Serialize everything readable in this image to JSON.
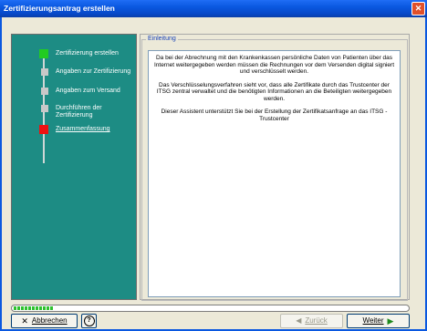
{
  "window": {
    "title": "Zertifizierungsantrag erstellen"
  },
  "steps": [
    {
      "label": "Zertifizierung erstellen",
      "state": "done",
      "color": "#22cc22"
    },
    {
      "label": "Angaben zur Zertifizierung",
      "state": "pending",
      "color": "#c8c8c8"
    },
    {
      "label": "Angaben zum Versand",
      "state": "pending",
      "color": "#c8c8c8"
    },
    {
      "label": "Durchführen der Zertifizierung",
      "state": "pending",
      "color": "#c8c8c8"
    },
    {
      "label": "Zusammenfassung",
      "state": "final",
      "color": "#ee1111"
    }
  ],
  "main": {
    "section_title": "Einleitung",
    "paragraphs": [
      "Da bei der Abrechnung mit den Krankenkassen persönliche Daten von Patienten über das Internet weitergegeben werden müssen die Rechnungen vor dem Versenden digital signiert und verschlüsselt werden.",
      "Das Verschlüsselungsverfahren sieht vor, dass alle Zertifikate durch das Trustcenter der ITSG zentral verwaltet und die benötigten Informationen an die Beteiligten weitergegeben werden.",
      "Dieser Assistent unterstützt Sie bei der Erstellung der Zertifikatsanfrage an das ITSG - Trustcenter"
    ]
  },
  "buttons": {
    "cancel": "Abbrechen",
    "help_glyph": "?",
    "back": "Zurück",
    "next": "Weiter"
  },
  "progress": {
    "filled_blocks": 11,
    "fraction": 0.1
  }
}
